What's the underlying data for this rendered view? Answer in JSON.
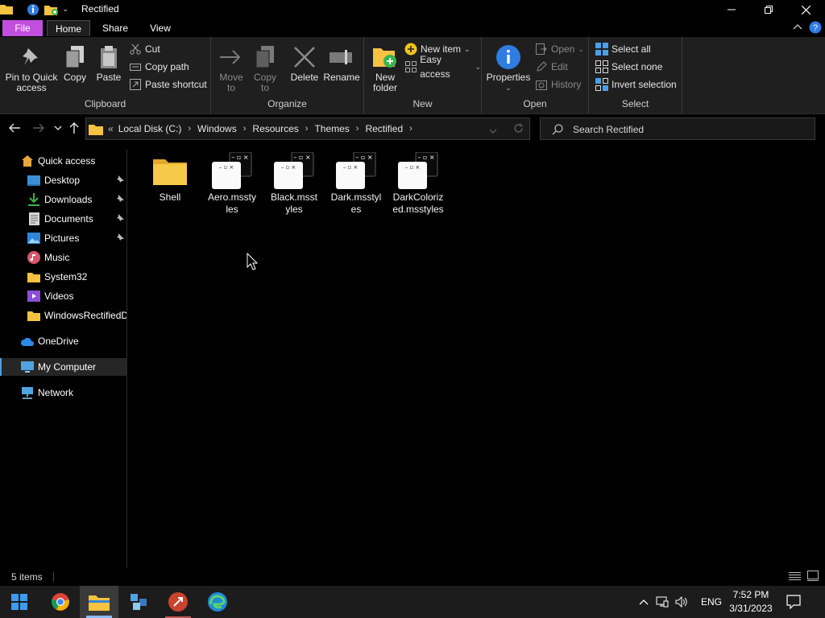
{
  "window": {
    "title": "Rectified"
  },
  "ribbon_tabs": {
    "file": "File",
    "home": "Home",
    "share": "Share",
    "view": "View"
  },
  "clipboard": {
    "pin": "Pin to Quick access",
    "pin_line1": "Pin to Quick",
    "pin_line2": "access",
    "copy": "Copy",
    "paste": "Paste",
    "cut": "Cut",
    "copy_path": "Copy path",
    "paste_shortcut": "Paste shortcut",
    "group": "Clipboard"
  },
  "organize": {
    "move_to_line1": "Move",
    "move_to_line2": "to",
    "copy_to_line1": "Copy",
    "copy_to_line2": "to",
    "delete": "Delete",
    "rename": "Rename",
    "group": "Organize"
  },
  "new": {
    "new_folder_line1": "New",
    "new_folder_line2": "folder",
    "new_item": "New item",
    "easy_access": "Easy access",
    "group": "New"
  },
  "open": {
    "properties": "Properties",
    "open": "Open",
    "edit": "Edit",
    "history": "History",
    "group": "Open"
  },
  "select": {
    "select_all": "Select all",
    "select_none": "Select none",
    "invert": "Invert selection",
    "group": "Select"
  },
  "address": {
    "overflow": "«",
    "crumbs": [
      "Local Disk (C:)",
      "Windows",
      "Resources",
      "Themes",
      "Rectified"
    ]
  },
  "search": {
    "placeholder": "Search Rectified"
  },
  "nav": {
    "quick_access": "Quick access",
    "items": [
      {
        "label": "Desktop",
        "pinned": true
      },
      {
        "label": "Downloads",
        "pinned": true
      },
      {
        "label": "Documents",
        "pinned": true
      },
      {
        "label": "Pictures",
        "pinned": true
      },
      {
        "label": "Music",
        "pinned": false
      },
      {
        "label": "System32",
        "pinned": false
      },
      {
        "label": "Videos",
        "pinned": false
      },
      {
        "label": "WindowsRectifiedD",
        "pinned": false
      }
    ],
    "onedrive": "OneDrive",
    "my_computer": "My Computer",
    "network": "Network"
  },
  "files": [
    {
      "line1": "Shell",
      "line2": "",
      "type": "folder"
    },
    {
      "line1": "Aero.mssty",
      "line2": "les",
      "type": "msstyles"
    },
    {
      "line1": "Black.msst",
      "line2": "yles",
      "type": "msstyles"
    },
    {
      "line1": "Dark.msstyl",
      "line2": "es",
      "type": "msstyles"
    },
    {
      "line1": "DarkColoriz",
      "line2": "ed.msstyles",
      "type": "msstyles"
    }
  ],
  "status": {
    "count": "5 items"
  },
  "taskbar": {
    "apps": [
      "start-icon",
      "chrome-icon",
      "file-explorer-icon",
      "control-panel-icon",
      "remote-app-icon",
      "edge-icon"
    ],
    "language": "ENG",
    "time": "7:52 PM",
    "date": "3/31/2023"
  },
  "colors": {
    "file_tab": "#c14fde",
    "accent": "#4ba0e8",
    "folder": "#f5c242"
  }
}
